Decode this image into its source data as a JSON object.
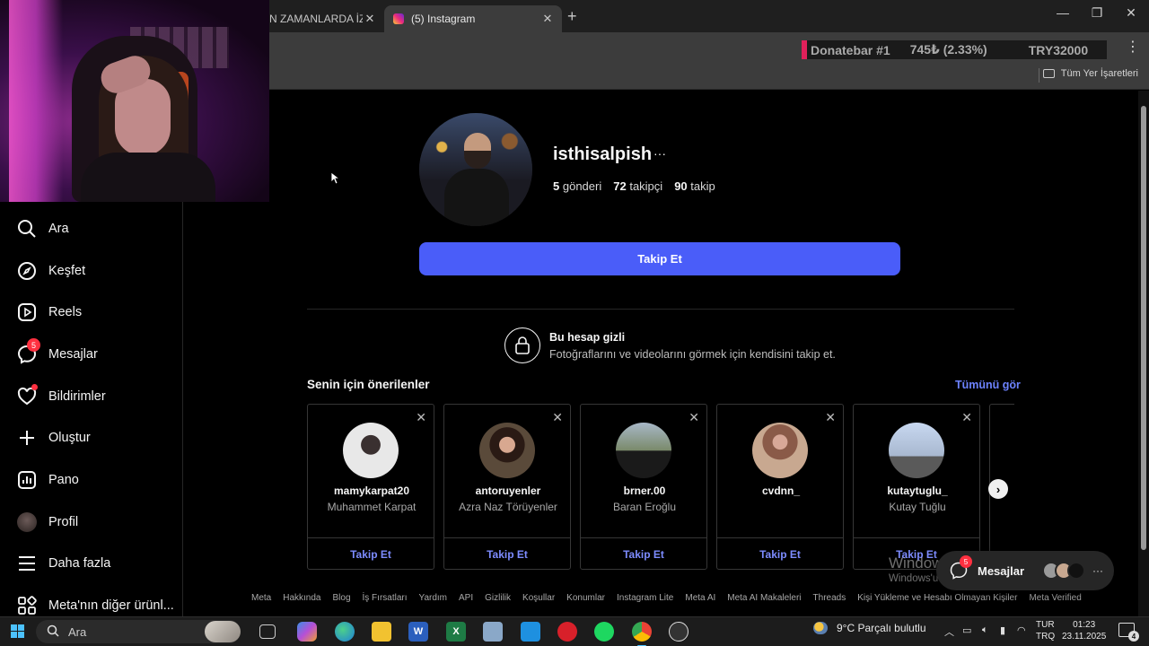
{
  "browser": {
    "tabs": [
      {
        "title": "N ZAMANLARDA İZLE"
      },
      {
        "title": "(5) Instagram"
      }
    ],
    "new_tab": "+",
    "bookmarks_all": "Tüm Yer İşaretleri"
  },
  "overlay": {
    "donatebar_name": "Donatebar #1",
    "donatebar_amount": "745₺ (2.33%)",
    "donatebar_goal": "TRY32000"
  },
  "sidebar": {
    "items": [
      {
        "label": "Ara",
        "icon": "search-icon"
      },
      {
        "label": "Keşfet",
        "icon": "compass-icon"
      },
      {
        "label": "Reels",
        "icon": "reels-icon"
      },
      {
        "label": "Mesajlar",
        "icon": "messenger-icon",
        "badge": "5"
      },
      {
        "label": "Bildirimler",
        "icon": "heart-icon"
      },
      {
        "label": "Oluştur",
        "icon": "plus-icon"
      },
      {
        "label": "Pano",
        "icon": "dashboard-icon"
      },
      {
        "label": "Profil",
        "icon": "avatar"
      },
      {
        "label": "Daha fazla",
        "icon": "menu-icon"
      },
      {
        "label": "Meta'nın diğer ürünl...",
        "icon": "apps-icon"
      }
    ]
  },
  "profile": {
    "username": "isthisalpish",
    "posts_count": "5",
    "posts_label": "gönderi",
    "followers_count": "72",
    "followers_label": "takipçi",
    "following_count": "90",
    "following_label": "takip",
    "follow_button": "Takip Et",
    "private_title": "Bu hesap gizli",
    "private_subtitle": "Fotoğraflarını ve videolarını görmek için kendisini takip et."
  },
  "suggestions": {
    "title": "Senin için önerilenler",
    "see_all": "Tümünü gör",
    "cards": [
      {
        "username": "mamykarpat20",
        "name": "Muhammet Karpat",
        "action": "Takip Et",
        "color": "#d8d8d8"
      },
      {
        "username": "antoruyenler",
        "name": "Azra Naz Törüyenler",
        "action": "Takip Et",
        "color": "#6a4a3a"
      },
      {
        "username": "brner.00",
        "name": "Baran Eroğlu",
        "action": "Takip Et",
        "color": "#7a8a9a"
      },
      {
        "username": "cvdnn_",
        "name": "",
        "action": "Takip Et",
        "color": "#c8a090"
      },
      {
        "username": "kutaytuglu_",
        "name": "Kutay Tuğlu",
        "action": "Takip Et",
        "color": "#a8b8d0"
      }
    ]
  },
  "footer": {
    "links": [
      "Meta",
      "Hakkında",
      "Blog",
      "İş Fırsatları",
      "Yardım",
      "API",
      "Gizlilik",
      "Koşullar",
      "Konumlar",
      "Instagram Lite",
      "Meta AI",
      "Meta AI Makaleleri",
      "Threads",
      "Kişi Yükleme ve Hesabı Olmayan Kişiler",
      "Meta Verified"
    ]
  },
  "messages_pill": {
    "label": "Mesajlar",
    "badge": "5"
  },
  "watermark": {
    "line1": "Windows'u Etkinleştir",
    "line2": "Windows'u etkinleştirmek için Ayarlar'a gidin."
  },
  "taskbar": {
    "search_text": "Ara",
    "weather": "9°C  Parçalı bulutlu",
    "lang_line1": "TUR",
    "lang_line2": "TRQ",
    "time": "01:23",
    "date": "23.11.2025",
    "notification_count": "4",
    "weather_badge": "3"
  },
  "colors": {
    "accent_blue": "#4a5df9",
    "link_blue": "#7d8cff",
    "badge_red": "#ff3040"
  }
}
